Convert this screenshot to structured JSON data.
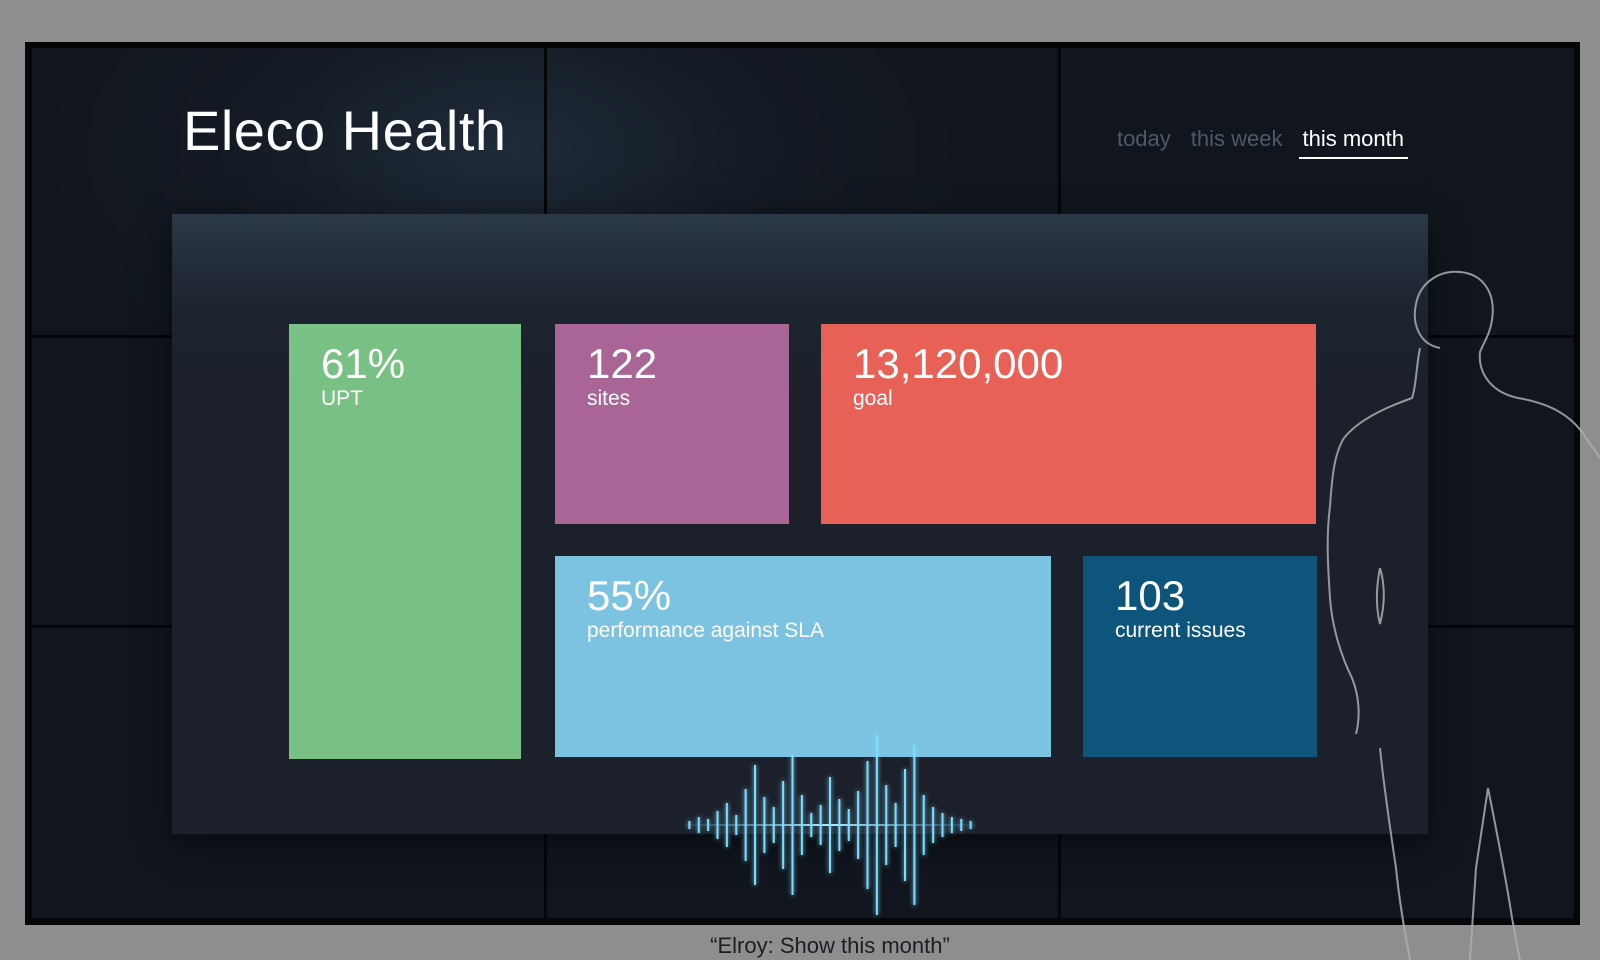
{
  "app": {
    "title": "Eleco Health"
  },
  "range_tabs": [
    {
      "label": "today",
      "active": false
    },
    {
      "label": "this week",
      "active": false
    },
    {
      "label": "this month",
      "active": true
    }
  ],
  "tiles": {
    "upt": {
      "value": "61%",
      "label": "UPT",
      "color": "#79c084"
    },
    "sites": {
      "value": "122",
      "label": "sites",
      "color": "#a86595"
    },
    "goal": {
      "value": "13,120,000",
      "label": "goal",
      "color": "#e86156"
    },
    "sla": {
      "value": "55%",
      "label": "performance against SLA",
      "color": "#7cc3e1"
    },
    "issues": {
      "value": "103",
      "label": "current issues",
      "color": "#0d557b"
    }
  },
  "voice": {
    "caption": "“Elroy: Show this month”"
  }
}
